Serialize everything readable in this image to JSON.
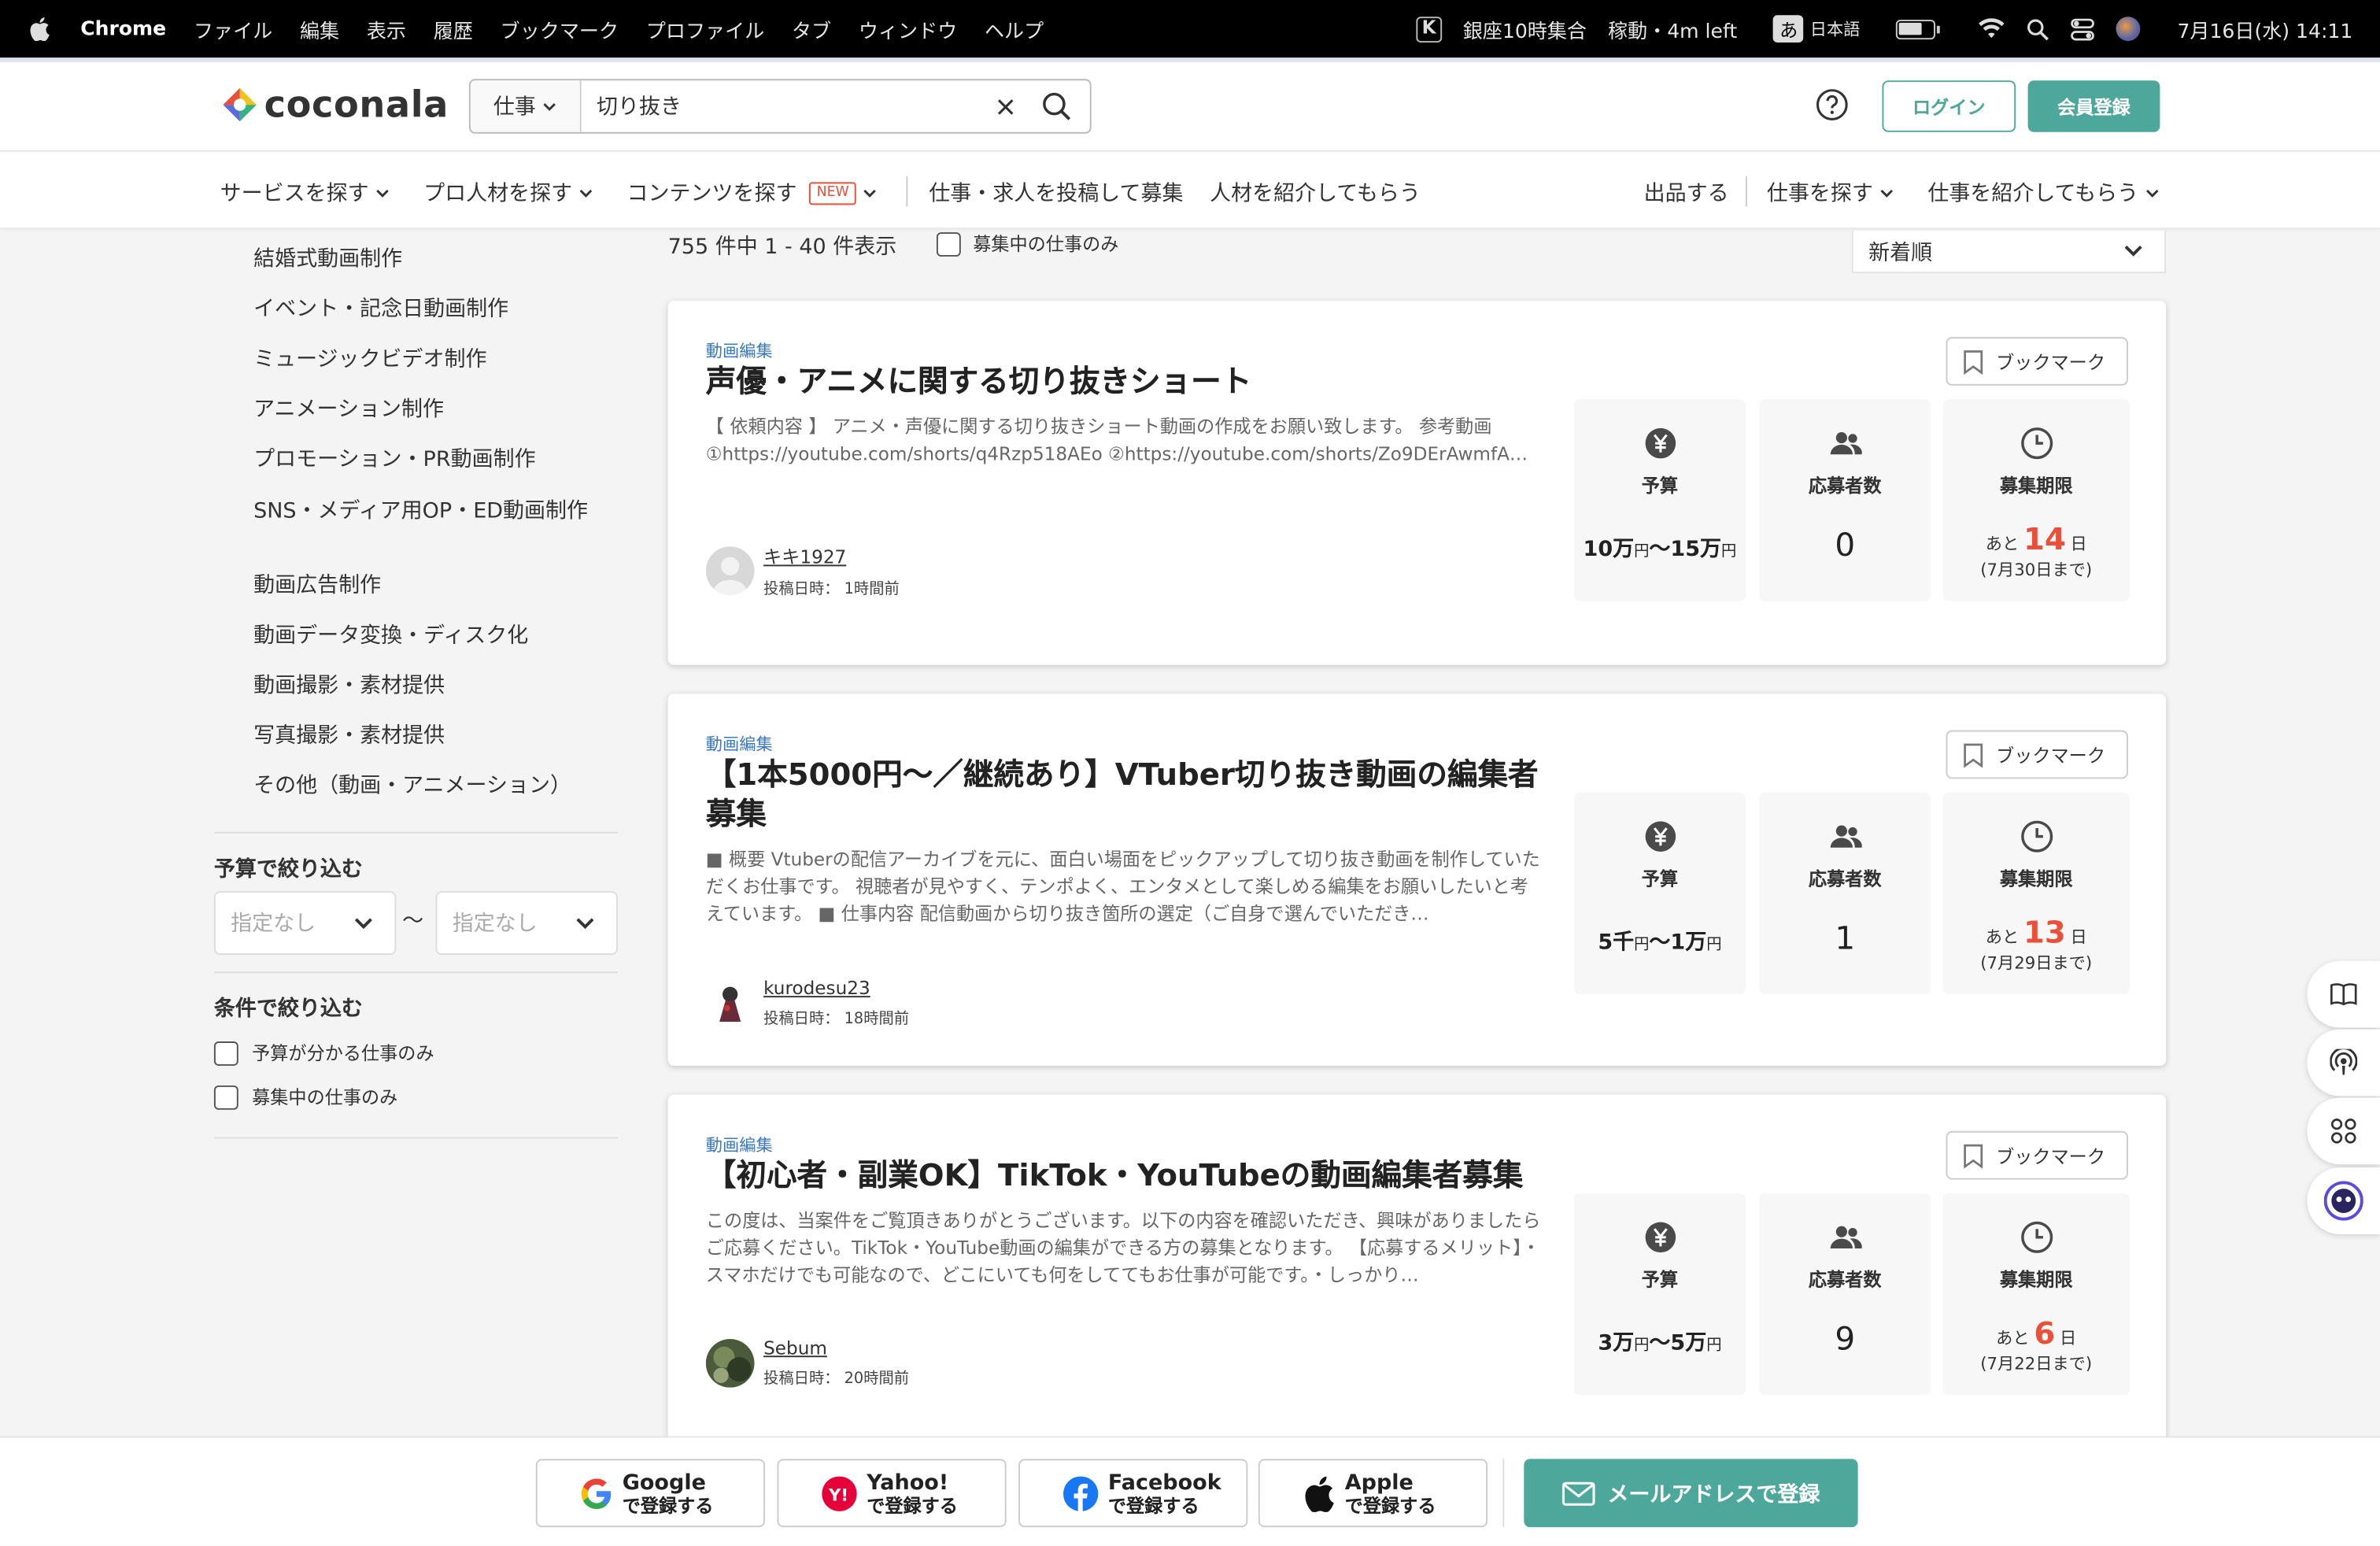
{
  "menubar": {
    "app": "Chrome",
    "menus": [
      "ファイル",
      "編集",
      "表示",
      "履歴",
      "ブックマーク",
      "プロファイル",
      "タブ",
      "ウィンドウ",
      "ヘルプ"
    ],
    "status_event": "銀座10時集合",
    "status_timer": "稼動・4m left",
    "ime_mode": "あ",
    "ime_lang": "日本語",
    "datetime": "7月16日(水) 14:11"
  },
  "header": {
    "logo_text": "coconala",
    "search_category": "仕事",
    "search_value": "切り抜き",
    "login_label": "ログイン",
    "signup_label": "会員登録",
    "accent_color": "#4ea79b"
  },
  "nav": {
    "items": [
      {
        "label": "サービスを探す"
      },
      {
        "label": "プロ人材を探す"
      },
      {
        "label": "コンテンツを探す",
        "badge": "NEW"
      },
      {
        "label": "仕事・求人を投稿して募集"
      },
      {
        "label": "人材を紹介してもらう"
      },
      {
        "label": "出品する"
      },
      {
        "label": "仕事を探す"
      },
      {
        "label": "仕事を紹介してもらう"
      }
    ]
  },
  "sidebar": {
    "categories": [
      "結婚式動画制作",
      "イベント・記念日動画制作",
      "ミュージックビデオ制作",
      "アニメーション制作",
      "プロモーション・PR動画制作",
      "SNS・メディア用OP・ED動画制作",
      "動画広告制作",
      "動画データ変換・ディスク化",
      "動画撮影・素材提供",
      "写真撮影・素材提供",
      "その他（動画・アニメーション）"
    ],
    "budget_heading": "予算で絞り込む",
    "budget_min_placeholder": "指定なし",
    "budget_max_placeholder": "指定なし",
    "budget_separator": "〜",
    "condition_heading": "条件で絞り込む",
    "conditions": [
      "予算が分かる仕事のみ",
      "募集中の仕事のみ"
    ]
  },
  "results": {
    "count_text": "755 件中 1 - 40 件表示",
    "open_only_label": "募集中の仕事のみ",
    "sort_value": "新着順"
  },
  "labels": {
    "bookmark": "ブックマーク",
    "budget": "予算",
    "applicants": "応募者数",
    "deadline": "募集期限",
    "deadline_prefix": "あと",
    "deadline_suffix": "日",
    "posted_prefix": "投稿日時："
  },
  "jobs": [
    {
      "category": "動画編集",
      "title": "声優・アニメに関する切り抜きショート",
      "description": "【 依頼内容 】 アニメ・声優に関する切り抜きショート動画の作成をお願い致します。 参考動画 ①https://youtube.com/shorts/q4Rzp518AEo ②https://youtube.com/shorts/Zo9DErAwmfA…",
      "user": "キキ1927",
      "posted": "1時間前",
      "budget_min": "10万",
      "budget_max": "15万",
      "budget_unit": "円",
      "applicants": "0",
      "days_left": "14",
      "deadline_date": "(7月30日まで)"
    },
    {
      "category": "動画編集",
      "title": "【1本5000円〜／継続あり】VTuber切り抜き動画の編集者募集",
      "description": "■ 概要 Vtuberの配信アーカイブを元に、面白い場面をピックアップして切り抜き動画を制作していただくお仕事です。 視聴者が見やすく、テンポよく、エンタメとして楽しめる編集をお願いしたいと考えています。 ■ 仕事内容 配信動画から切り抜き箇所の選定（ご自身で選んでいただき…",
      "user": "kurodesu23",
      "posted": "18時間前",
      "budget_min": "5千",
      "budget_max": "1万",
      "budget_unit": "円",
      "applicants": "1",
      "days_left": "13",
      "deadline_date": "(7月29日まで)"
    },
    {
      "category": "動画編集",
      "title": "【初心者・副業OK】TikTok・YouTubeの動画編集者募集",
      "description": "この度は、当案件をご覧頂きありがとうございます。以下の内容を確認いただき、興味がありましたらご応募ください。TikTok・YouTube動画の編集ができる方の募集となります。 【応募するメリット】・スマホだけでも可能なので、どこにいても何をしててもお仕事が可能です。・しっかり…",
      "user": "Sebum",
      "posted": "20時間前",
      "budget_min": "3万",
      "budget_max": "5万",
      "budget_unit": "円",
      "applicants": "9",
      "days_left": "6",
      "deadline_date": "(7月22日まで)"
    }
  ],
  "bottom_bar": {
    "google": {
      "name": "Google",
      "action": "で登録する"
    },
    "yahoo": {
      "name": "Yahoo!",
      "action": "で登録する"
    },
    "facebook": {
      "name": "Facebook",
      "action": "で登録する"
    },
    "apple": {
      "name": "Apple",
      "action": "で登録する"
    },
    "mail_label": "メールアドレスで登録"
  }
}
